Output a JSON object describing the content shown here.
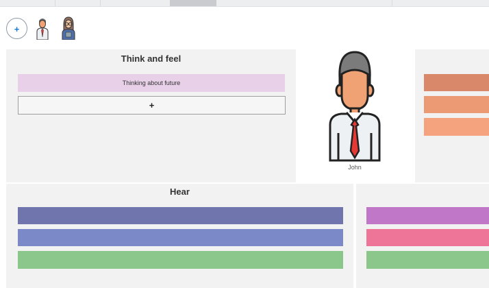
{
  "toolbar": {
    "add_label": "+",
    "add_icon": "plus-icon",
    "avatars": [
      {
        "icon": "businessman-avatar-icon"
      },
      {
        "icon": "woman-avatar-icon"
      }
    ]
  },
  "think_feel": {
    "title": "Think and feel",
    "note": "Thinking about future",
    "note_color": "#e8d0e8",
    "add_label": "+"
  },
  "persona": {
    "name": "John",
    "icon": "businessman-icon"
  },
  "right_panel": {
    "bars": [
      {
        "color": "#d9886a"
      },
      {
        "color": "#ec9a73"
      },
      {
        "color": "#f5a27f"
      }
    ]
  },
  "hear": {
    "title": "Hear",
    "bars": [
      {
        "color": "#7075ad"
      },
      {
        "color": "#7c89c8"
      },
      {
        "color": "#8bc68b"
      }
    ]
  },
  "bottom_right": {
    "bars": [
      {
        "color": "#c077c8"
      },
      {
        "color": "#ef7598"
      },
      {
        "color": "#8bc68b"
      }
    ]
  }
}
